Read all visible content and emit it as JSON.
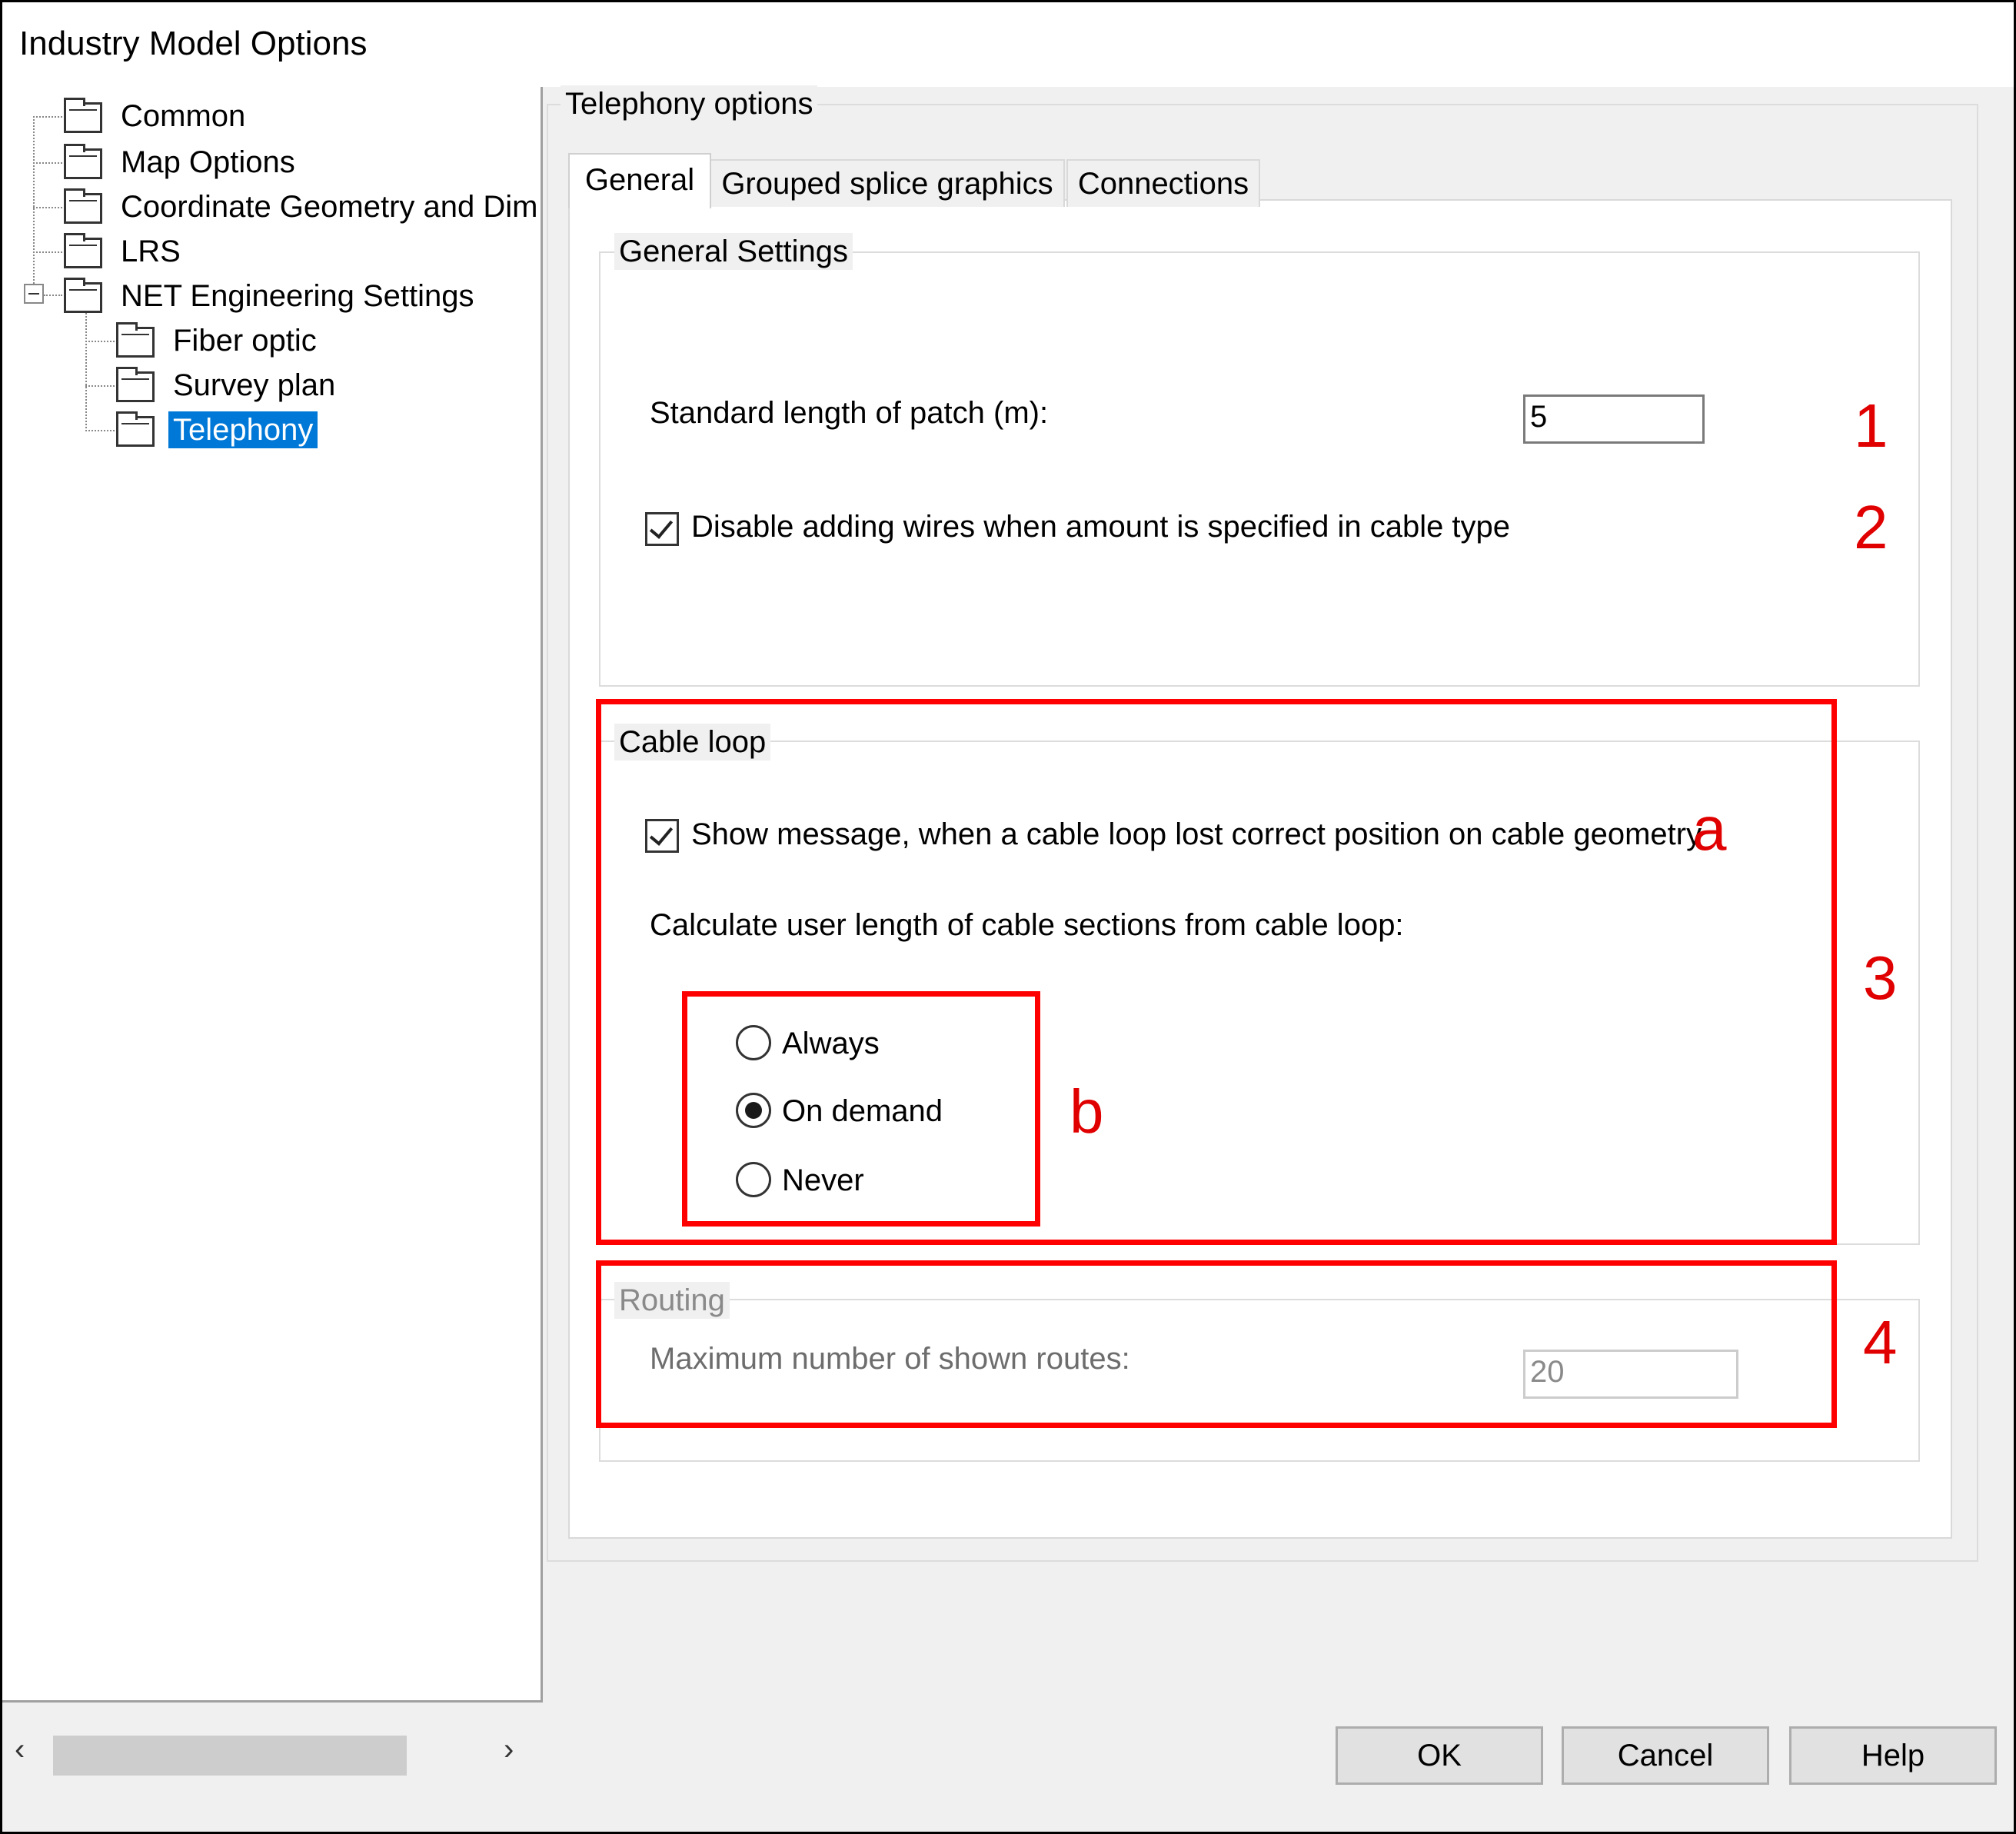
{
  "window": {
    "title": "Industry Model Options"
  },
  "tree": {
    "items": [
      {
        "label": "Common"
      },
      {
        "label": "Map Options"
      },
      {
        "label": "Coordinate Geometry and Dime"
      },
      {
        "label": "LRS"
      },
      {
        "label": "NET Engineering Settings"
      },
      {
        "label": "Fiber optic"
      },
      {
        "label": "Survey plan"
      },
      {
        "label": "Telephony",
        "selected": true
      }
    ]
  },
  "panel": {
    "title": "Telephony options",
    "tabs": [
      {
        "label": "General",
        "active": true
      },
      {
        "label": "Grouped splice graphics"
      },
      {
        "label": "Connections"
      }
    ],
    "general_settings": {
      "title": "General Settings",
      "patch_label": "Standard length of patch (m):",
      "patch_value": "5",
      "disable_wires_label": "Disable adding wires when amount is specified in cable type",
      "disable_wires_checked": true
    },
    "cable_loop": {
      "title": "Cable loop",
      "show_message_label": "Show message, when a cable loop lost correct position on cable geometry",
      "show_message_checked": true,
      "calc_label": "Calculate user length of cable sections from cable loop:",
      "options": [
        "Always",
        "On demand",
        "Never"
      ],
      "selected": "On demand"
    },
    "routing": {
      "title": "Routing",
      "max_routes_label": "Maximum number of shown routes:",
      "max_routes_value": "20"
    }
  },
  "annotations": {
    "labels": [
      "1",
      "2",
      "3",
      "4",
      "a",
      "b"
    ],
    "color": "#ff0000"
  },
  "buttons": {
    "ok": "OK",
    "cancel": "Cancel",
    "help": "Help"
  }
}
